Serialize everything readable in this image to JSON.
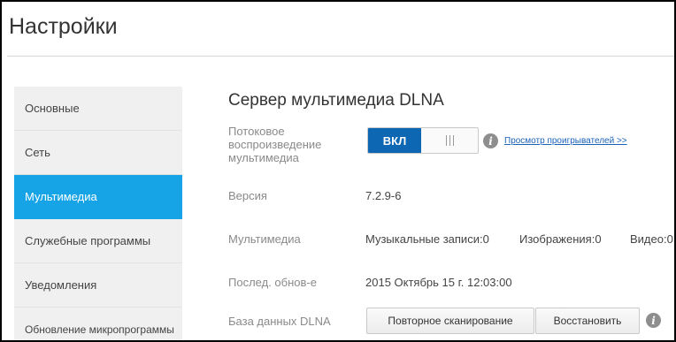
{
  "header": {
    "title": "Настройки"
  },
  "sidebar": {
    "items": [
      {
        "label": "Основные"
      },
      {
        "label": "Сеть"
      },
      {
        "label": "Мультимедиа"
      },
      {
        "label": "Служебные программы"
      },
      {
        "label": "Уведомления"
      },
      {
        "label": "Обновление микропрограммы"
      }
    ],
    "active": "Мультимедиа"
  },
  "main": {
    "section_title": "Сервер мультимедиа DLNA",
    "streaming": {
      "label": "Потоковое воспроизведение мультимедиа",
      "toggle_state": "ВКЛ",
      "players_link": "Просмотр проигрывателей >>"
    },
    "version": {
      "label": "Версия",
      "value": "7.2.9-6"
    },
    "media": {
      "label": "Мультимедиа",
      "music": "Музыкальные записи:0",
      "images": "Изображения:0",
      "video": "Видео:0"
    },
    "last_update": {
      "label": "Послед. обнов-е",
      "value": "2015 Октябрь 15 г. 12:03:00"
    },
    "dlna_db": {
      "label": "База данных DLNA",
      "rescan_button": "Повторное сканирование",
      "restore_button": "Восстановить"
    }
  },
  "colors": {
    "accent": "#17a4e6",
    "toggle_on": "#0d67b3",
    "link": "#1a62b8"
  },
  "icons": {
    "info": "info-icon"
  }
}
